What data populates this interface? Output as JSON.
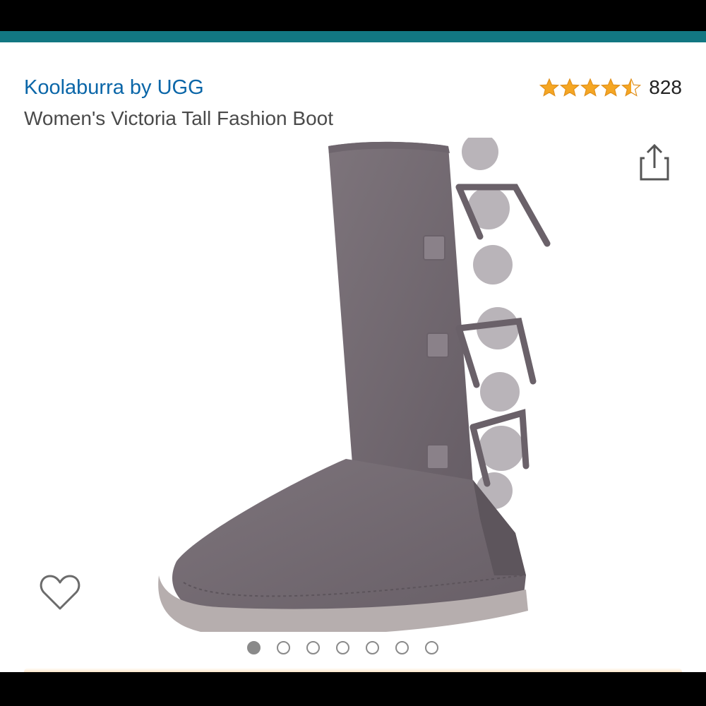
{
  "product": {
    "brand": "Koolaburra by UGG",
    "title": "Women's Victoria Tall Fashion Boot",
    "rating_value": 4.5,
    "rating_max": 5,
    "review_count": "828"
  },
  "icons": {
    "share": "share-icon",
    "wishlist": "heart-icon",
    "rating": "star-icon"
  },
  "gallery": {
    "image_count": 7,
    "active_index": 0,
    "image_subject": "boot"
  },
  "colors": {
    "brand_link": "#0a66a8",
    "header_bar": "#127782",
    "star_fill": "#f5a623",
    "dot": "#8a8a8a"
  }
}
